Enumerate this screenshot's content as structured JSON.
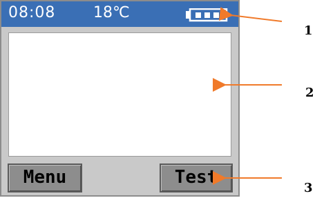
{
  "status_bar": {
    "time": "08:08",
    "temperature": "18℃",
    "battery_icon": "battery-icon"
  },
  "softkeys": {
    "left_label": "Menu",
    "right_label": "Test"
  },
  "callouts": {
    "labels": [
      "1",
      "2",
      "3"
    ]
  },
  "colors": {
    "status_bar": "#3a6fb5",
    "arrow": "#f07a2a"
  }
}
